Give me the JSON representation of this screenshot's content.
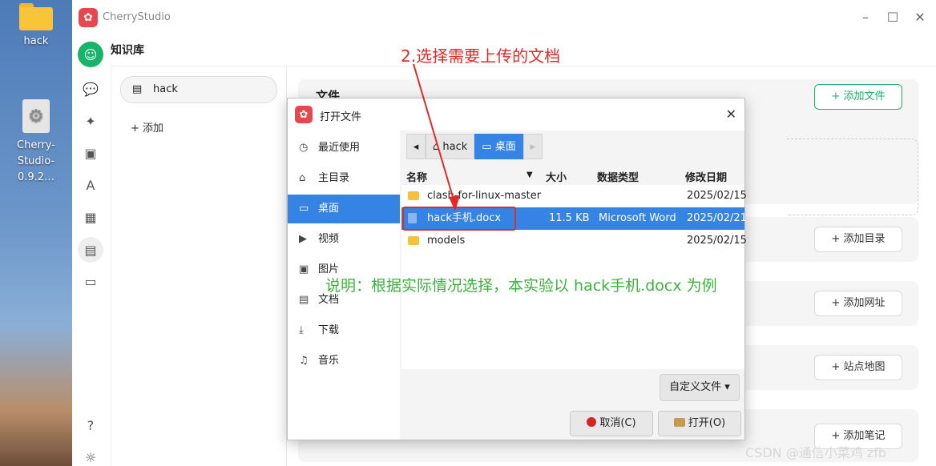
{
  "desktop": {
    "icons": [
      {
        "label": "hack",
        "icon": "folder-icon"
      },
      {
        "label": "Cherry-\nStudio-0.9.2…",
        "icon": "app-file-icon"
      }
    ]
  },
  "app": {
    "name": "CherryStudio",
    "section_title": "知识库",
    "kb_item": "hack",
    "add_label": "+ 添加",
    "cards": [
      {
        "title": "文件",
        "button": "+ 添加文件"
      },
      {
        "title": "",
        "button": "+ 添加目录"
      },
      {
        "title": "",
        "button": "+ 添加网址"
      },
      {
        "title": "",
        "button": "+ 站点地图"
      },
      {
        "title": "",
        "button": "+ 添加笔记"
      }
    ]
  },
  "dialog": {
    "title": "打开文件",
    "places": [
      "最近使用",
      "主目录",
      "桌面",
      "视频",
      "图片",
      "文档",
      "下载",
      "音乐"
    ],
    "selected_place": "桌面",
    "breadcrumbs": [
      "hack",
      "桌面"
    ],
    "columns": [
      "名称",
      "大小",
      "数据类型",
      "修改日期"
    ],
    "files": [
      {
        "name": "clash-for-linux-master",
        "size": "",
        "type": "",
        "date": "2025/02/15",
        "kind": "folder"
      },
      {
        "name": "hack手机.docx",
        "size": "11.5 KB",
        "type": "Microsoft Word",
        "date": "2025/02/21",
        "kind": "doc"
      },
      {
        "name": "models",
        "size": "",
        "type": "",
        "date": "2025/02/15",
        "kind": "folder"
      }
    ],
    "filter": "自定义文件 ▾",
    "cancel": "取消(C)",
    "open": "打开(O)"
  },
  "annotations": {
    "step": "2.选择需要上传的文档",
    "note": "说明：根据实际情况选择，本实验以 hack手机.docx 为例"
  },
  "watermark": "CSDN @通信小菜鸡 zfb",
  "colors": {
    "accent": "#19b46b",
    "selection": "#3584e4",
    "annotation_red": "#e02b2b",
    "annotation_green": "#3cb33c"
  }
}
